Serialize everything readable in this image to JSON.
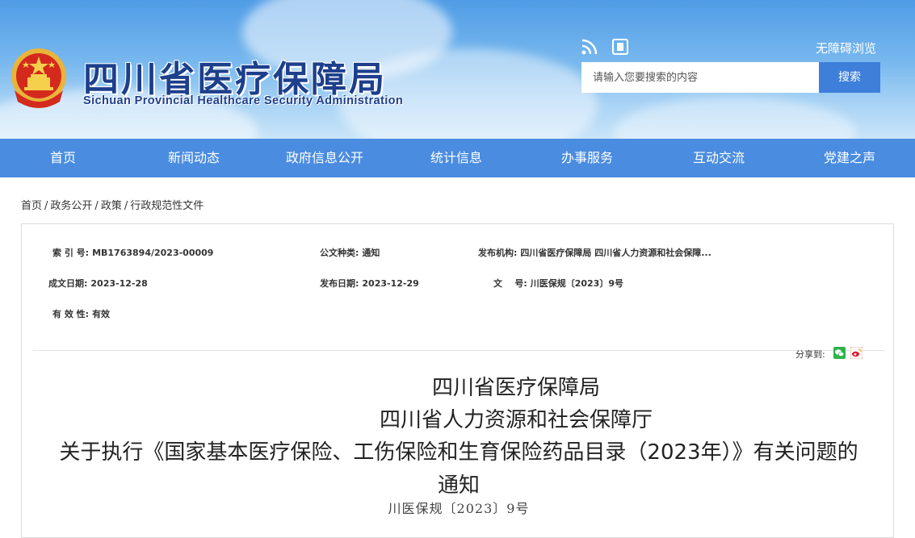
{
  "header": {
    "title_cn": "四川省医疗保障局",
    "title_en": "Sichuan Provincial Healthcare Security Administration",
    "accessible_link": "无障碍浏览",
    "search_placeholder": "请输入您要搜索的内容",
    "search_button": "搜索",
    "icons": [
      "rss-icon",
      "mobile-app-icon",
      "national-emblem"
    ],
    "colors": {
      "sky": "#4f9ce6",
      "title": "#1d3f8c",
      "search_button": "#3e7fdb"
    }
  },
  "nav": {
    "items": [
      {
        "label": "首页"
      },
      {
        "label": "新闻动态"
      },
      {
        "label": "政府信息公开"
      },
      {
        "label": "统计信息"
      },
      {
        "label": "办事服务"
      },
      {
        "label": "互动交流"
      },
      {
        "label": "党建之声"
      }
    ],
    "color": "#4a8ce0"
  },
  "breadcrumb": {
    "items": [
      "首页",
      "政务公开",
      "政策",
      "行政规范性文件"
    ],
    "separator": "/"
  },
  "meta": {
    "index_label": "索 引 号:",
    "index_value": "MB1763894/2023-00009",
    "doc_type_label": "公文种类:",
    "doc_type_value": "通知",
    "issuer_label": "发布机构:",
    "issuer_value": "四川省医疗保障局 四川省人力资源和社会保障...",
    "created_label": "成文日期:",
    "created_value": "2023-12-28",
    "published_label": "发布日期:",
    "published_value": "2023-12-29",
    "doc_no_label": "文    号:",
    "doc_no_value": "川医保规〔2023〕9号",
    "validity_label": "有 效 性:",
    "validity_value": "有效"
  },
  "share": {
    "label": "分享到:",
    "icons": [
      "wechat-icon",
      "weibo-icon"
    ]
  },
  "document": {
    "title_line1": "四川省医疗保障局",
    "title_line2": "四川省人力资源和社会保障厅",
    "title_line3": "关于执行《国家基本医疗保险、工伤保险和生育保险药品目录（2023年）》有关问题的",
    "title_line4": "通知",
    "doc_number": "川医保规〔2023〕9号"
  }
}
